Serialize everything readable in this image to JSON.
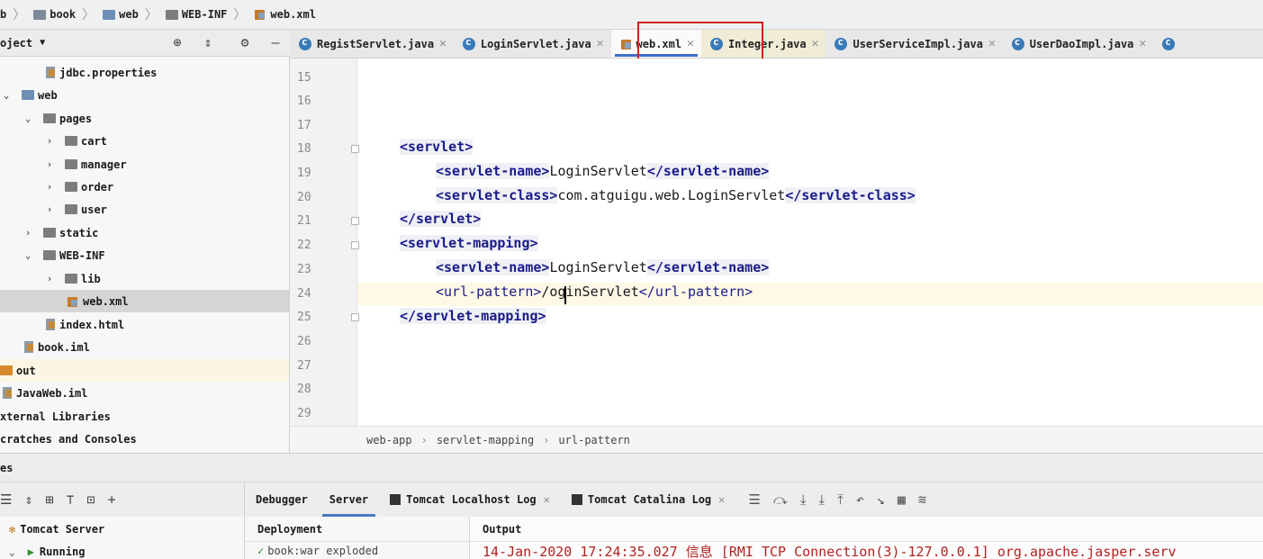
{
  "breadcrumb": {
    "items": [
      "b",
      "book",
      "web",
      "WEB-INF",
      "web.xml"
    ]
  },
  "project_toolbar": {
    "title": "oject",
    "icons": [
      "target-icon",
      "collapse-icon",
      "gear-icon",
      "minimize-icon"
    ]
  },
  "tabs": [
    {
      "label": "RegistServlet.java",
      "icon": "class-icon",
      "active": false
    },
    {
      "label": "LoginServlet.java",
      "icon": "class-icon",
      "active": false
    },
    {
      "label": "web.xml",
      "icon": "xml-icon",
      "active": true
    },
    {
      "label": "Integer.java",
      "icon": "class-icon",
      "active": false
    },
    {
      "label": "UserServiceImpl.java",
      "icon": "class-icon",
      "active": false
    },
    {
      "label": "UserDaoImpl.java",
      "icon": "class-icon",
      "active": false
    }
  ],
  "tree": {
    "jdbc": "jdbc.properties",
    "web": "web",
    "pages": "pages",
    "cart": "cart",
    "manager": "manager",
    "order": "order",
    "user": "user",
    "static": "static",
    "webinf": "WEB-INF",
    "lib": "lib",
    "webxml": "web.xml",
    "index": "index.html",
    "bookiml": "book.iml",
    "out": "out",
    "javaweb": "JavaWeb.iml",
    "external": "xternal Libraries",
    "scratches": "cratches and Consoles"
  },
  "editor": {
    "line_numbers": [
      "15",
      "16",
      "17",
      "18",
      "19",
      "20",
      "21",
      "22",
      "23",
      "24",
      "25",
      "26",
      "27",
      "28",
      "29"
    ],
    "line18": "<servlet>",
    "line19_open": "<servlet-name>",
    "line19_text": "LoginServlet",
    "line19_close": "</servlet-name>",
    "line20_open": "<servlet-class>",
    "line20_text": "com.atguigu.web.LoginServlet",
    "line20_close": "</servlet-class>",
    "line21": "</servlet>",
    "line22": "<servlet-mapping>",
    "line23_open": "<servlet-name>",
    "line23_text": "LoginServlet",
    "line23_close": "</servlet-name>",
    "line24_open": "<url-pattern>",
    "line24_text": "/oginServlet",
    "line24_close": "</url-pattern>",
    "line25": "</servlet-mapping>"
  },
  "editor_breadcrumb": [
    "web-app",
    "servlet-mapping",
    "url-pattern"
  ],
  "services": {
    "band_label": "es",
    "tree_root": "Tomcat Server",
    "tree_child": "Running"
  },
  "server_tabs": [
    "Debugger",
    "Server",
    "Tomcat Localhost Log",
    "Tomcat Catalina Log"
  ],
  "deployment": {
    "header": "Deployment",
    "item": "book:war exploded"
  },
  "output": {
    "header": "Output",
    "log": "14-Jan-2020 17:24:35.027 信息 [RMI TCP Connection(3)-127.0.0.1] org.apache.jasper.serv"
  },
  "colors": {
    "tag": "#1a1a8c",
    "active_tab_underline": "#3c6fc8",
    "highlight_box": "#d42020",
    "log_text": "#b22222"
  }
}
